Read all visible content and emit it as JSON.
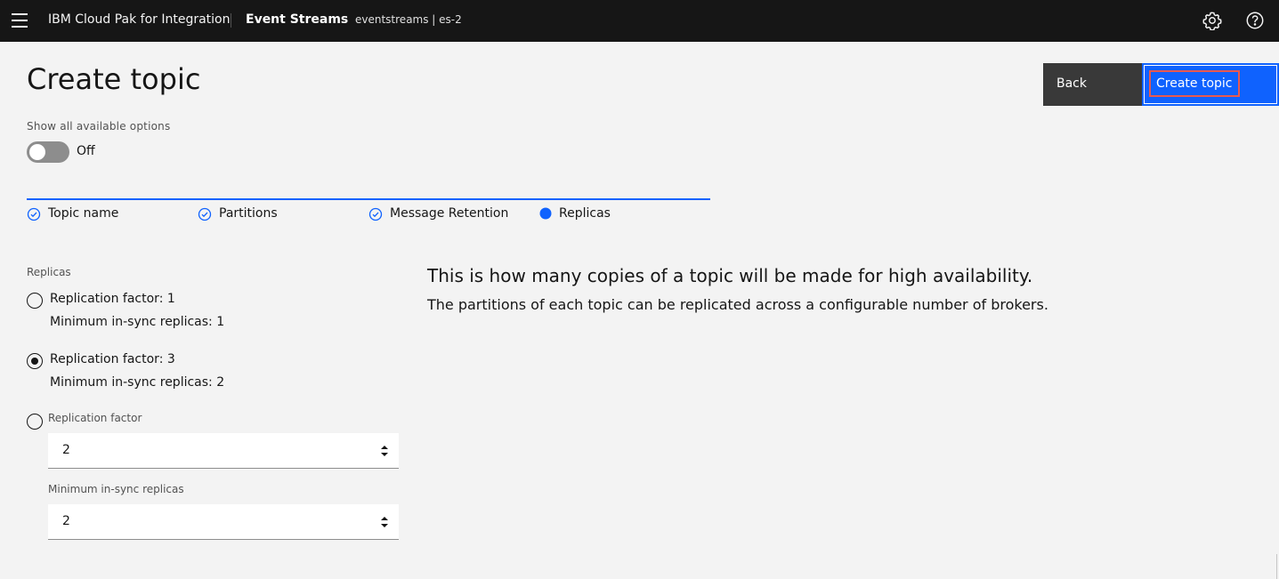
{
  "header": {
    "product": "IBM Cloud Pak for Integration",
    "app_name": "Event Streams",
    "instance": "eventstreams | es-2",
    "icons": [
      "menu-icon",
      "settings-icon",
      "help-icon"
    ]
  },
  "page": {
    "title": "Create topic",
    "back_label": "Back",
    "create_label": "Create topic"
  },
  "toggle": {
    "label": "Show all available options",
    "state": "Off",
    "on": false
  },
  "steps": [
    {
      "label": "Topic name",
      "status": "complete"
    },
    {
      "label": "Partitions",
      "status": "complete"
    },
    {
      "label": "Message Retention",
      "status": "complete"
    },
    {
      "label": "Replicas",
      "status": "current"
    }
  ],
  "form": {
    "section_label": "Replicas",
    "options": [
      {
        "line1": "Replication factor: 1",
        "line2": "Minimum in-sync replicas: 1",
        "selected": false
      },
      {
        "line1": "Replication factor: 3",
        "line2": "Minimum in-sync replicas: 2",
        "selected": true
      }
    ],
    "custom": {
      "selected": false,
      "replication_label": "Replication factor",
      "replication_value": "2",
      "min_isr_label": "Minimum in-sync replicas",
      "min_isr_value": "2"
    }
  },
  "info": {
    "title": "This is how many copies of a topic will be made for high availability.",
    "body": "The partitions of each topic can be replicated across a configurable number of brokers."
  },
  "colors": {
    "header_bg": "#161616",
    "primary": "#0f62fe",
    "secondary": "#393939",
    "background": "#f3f3f3",
    "focus_outline": "#e8594f"
  }
}
